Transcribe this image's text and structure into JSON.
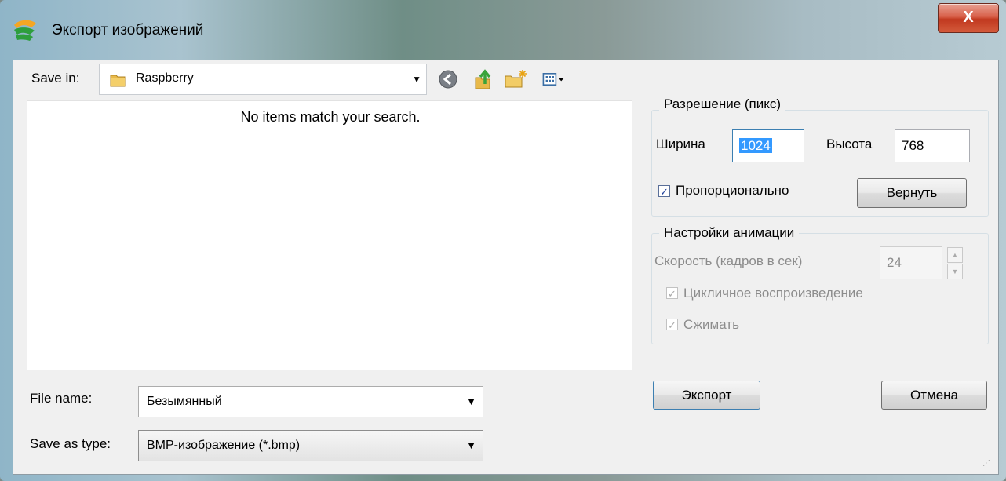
{
  "window": {
    "title": "Экспорт изображений",
    "close_label": "X",
    "accent": "#c1391f"
  },
  "toolbar": {
    "save_in_label": "Save in:",
    "save_in_value": "Raspberry",
    "icons": [
      "back-icon",
      "up-folder-icon",
      "new-folder-icon",
      "view-menu-icon"
    ]
  },
  "file_list": {
    "empty_message": "No items match your search."
  },
  "file_name": {
    "label": "File name:",
    "value": "Безымянный"
  },
  "file_type": {
    "label": "Save as type:",
    "value": "BMP-изображение (*.bmp)"
  },
  "resolution": {
    "legend": "Разрешение (пикс)",
    "width_label": "Ширина",
    "width_value": "1024",
    "height_label": "Высота",
    "height_value": "768",
    "proportional_label": "Пропорционально",
    "proportional_checked": true,
    "reset_label": "Вернуть"
  },
  "animation": {
    "legend": "Настройки анимации",
    "speed_label": "Скорость (кадров в сек)",
    "speed_value": "24",
    "loop_label": "Цикличное воспроизведение",
    "loop_checked": true,
    "compress_label": "Сжимать",
    "compress_checked": true
  },
  "actions": {
    "export_label": "Экспорт",
    "cancel_label": "Отмена"
  }
}
